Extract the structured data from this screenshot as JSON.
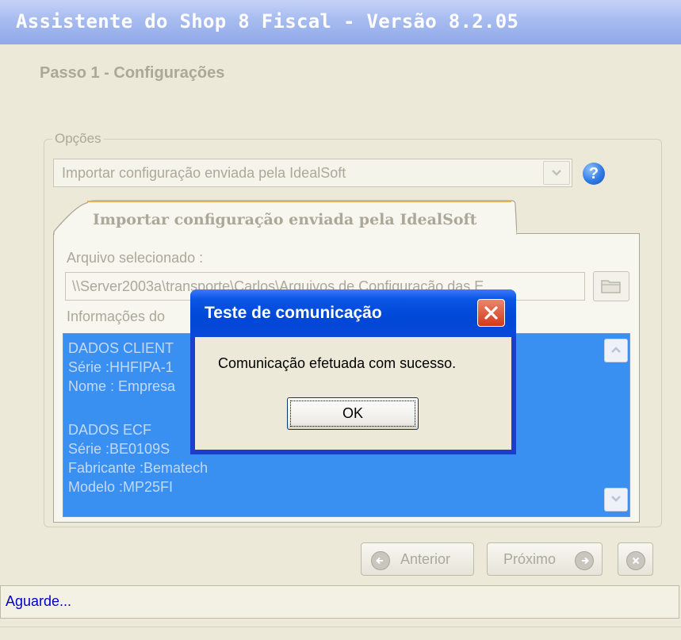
{
  "window": {
    "title": "Assistente do Shop 8 Fiscal - Versão 8.2.05"
  },
  "step": {
    "title": "Passo 1 - Configurações"
  },
  "options": {
    "legend": "Opções",
    "selected": "Importar configuração enviada pela IdealSoft",
    "help_icon": "question-circle-icon"
  },
  "tab": {
    "label": "Importar configuração enviada pela IdealSoft",
    "file_label": "Arquivo selecionado :",
    "file_path": "\\\\Server2003a\\transporte\\Carlos\\Arquivos de Configuração das E",
    "info_label": "Informações do",
    "info_lines": [
      "DADOS CLIENT",
      "Série :HHFIPA-1",
      "Nome : Empresa",
      "",
      "DADOS ECF",
      "Série :BE0109S",
      "Fabricante :Bematech",
      "Modelo :MP25FI"
    ]
  },
  "nav": {
    "prev_label": "Anterior",
    "next_label": "Próximo"
  },
  "status": {
    "text": "Aguarde..."
  },
  "dialog": {
    "title": "Teste de comunicação",
    "message": "Comunicação efetuada com sucesso.",
    "ok_label": "OK"
  },
  "colors": {
    "accent": "#0a55e5",
    "memo_bg": "#3990f0",
    "status_text": "#0000c8",
    "close": "#d5381a"
  }
}
